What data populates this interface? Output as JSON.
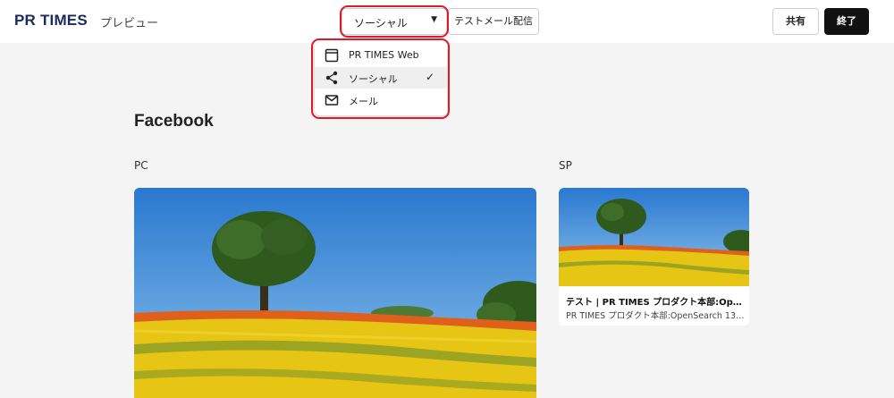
{
  "header": {
    "logo_text": "PR TIMES",
    "preview_label": "プレビュー",
    "channel_select": {
      "value": "ソーシャル"
    },
    "test_mail_label": "テストメール配信",
    "share_label": "共有",
    "end_label": "終了"
  },
  "dropdown": {
    "items": [
      {
        "label": "PR TIMES Web",
        "icon": "browser-window-icon",
        "selected": false
      },
      {
        "label": "ソーシャル",
        "icon": "share-icon",
        "selected": true
      },
      {
        "label": "メール",
        "icon": "mail-icon",
        "selected": false
      }
    ]
  },
  "main": {
    "title": "Facebook",
    "pc_label": "PC",
    "sp_label": "SP",
    "sp_card": {
      "title": "テスト | PR TIMES プロダクト本部:OpenSearch…",
      "subtitle": "PR TIMES プロダクト本部:OpenSearch 13…"
    }
  },
  "colors": {
    "accent_red": "#e0192b",
    "logo_navy": "#1b2b5e",
    "end_button_bg": "#111111"
  }
}
